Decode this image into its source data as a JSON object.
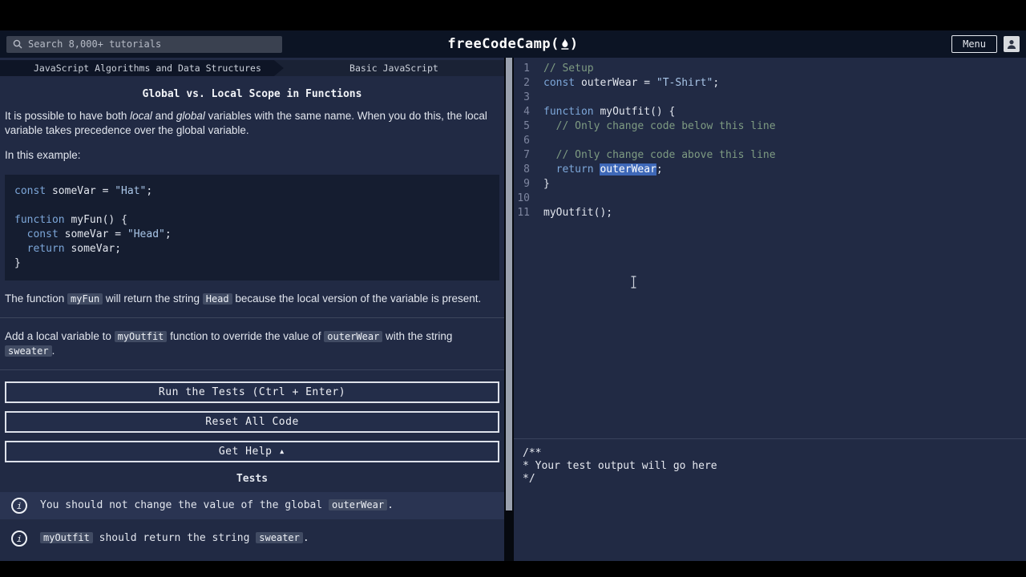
{
  "colors": {
    "selection_highlight": "#3e68b8",
    "panel_background": "#212a44",
    "header_background": "#0c1424",
    "comment_green": "#7e9b82",
    "keyword_blue": "#7da7d9"
  },
  "header": {
    "search_placeholder": "Search 8,000+ tutorials",
    "logo_text": "freeCodeCamp",
    "logo_open": "(",
    "logo_close": ")",
    "menu_label": "Menu"
  },
  "breadcrumb": {
    "superblock": "JavaScript Algorithms and Data Structures",
    "block": "Basic JavaScript"
  },
  "panel": {
    "title": "Global vs. Local Scope in Functions",
    "intro": [
      {
        "text": "It is possible to have both ",
        "style": "plain"
      },
      {
        "text": "local",
        "style": "italic"
      },
      {
        "text": " and ",
        "style": "plain"
      },
      {
        "text": "global",
        "style": "italic"
      },
      {
        "text": " variables with the same name. When you do this, the local variable takes precedence over the global variable.",
        "style": "plain"
      }
    ],
    "example_label": "In this example:",
    "example_code": [
      [
        {
          "t": "const",
          "c": "kw"
        },
        {
          "t": " someVar = ",
          "c": "pl"
        },
        {
          "t": "\"Hat\"",
          "c": "str"
        },
        {
          "t": ";",
          "c": "pl"
        }
      ],
      [],
      [
        {
          "t": "function",
          "c": "kw"
        },
        {
          "t": " myFun() {",
          "c": "pl"
        }
      ],
      [
        {
          "t": "  ",
          "c": "pl"
        },
        {
          "t": "const",
          "c": "kw"
        },
        {
          "t": " someVar = ",
          "c": "pl"
        },
        {
          "t": "\"Head\"",
          "c": "str"
        },
        {
          "t": ";",
          "c": "pl"
        }
      ],
      [
        {
          "t": "  ",
          "c": "pl"
        },
        {
          "t": "return",
          "c": "kw"
        },
        {
          "t": " someVar;",
          "c": "pl"
        }
      ],
      [
        {
          "t": "}",
          "c": "pl"
        }
      ]
    ],
    "explain": [
      {
        "text": "The function ",
        "style": "plain"
      },
      {
        "text": "myFun",
        "style": "code"
      },
      {
        "text": " will return the string ",
        "style": "plain"
      },
      {
        "text": "Head",
        "style": "code"
      },
      {
        "text": " because the local version of the variable is present.",
        "style": "plain"
      }
    ],
    "instructions": [
      {
        "text": "Add a local variable to ",
        "style": "plain"
      },
      {
        "text": "myOutfit",
        "style": "code"
      },
      {
        "text": " function to override the value of ",
        "style": "plain"
      },
      {
        "text": "outerWear",
        "style": "code"
      },
      {
        "text": " with the string ",
        "style": "plain"
      },
      {
        "text": "sweater",
        "style": "code"
      },
      {
        "text": ".",
        "style": "plain"
      }
    ],
    "buttons": {
      "run": "Run the Tests (Ctrl + Enter)",
      "reset": "Reset All Code",
      "help": "Get Help ▴"
    },
    "tests_heading": "Tests",
    "test_icon_glyph": "i",
    "tests": [
      {
        "parts": [
          {
            "text": "You should not change the value of the global ",
            "style": "plain"
          },
          {
            "text": "outerWear",
            "style": "code"
          },
          {
            "text": ".",
            "style": "plain"
          }
        ]
      },
      {
        "parts": [
          {
            "text": "myOutfit",
            "style": "code"
          },
          {
            "text": " should return the string ",
            "style": "plain"
          },
          {
            "text": "sweater",
            "style": "code"
          },
          {
            "text": ".",
            "style": "plain"
          }
        ]
      }
    ]
  },
  "editor": {
    "lines": [
      {
        "n": "1",
        "tokens": [
          {
            "t": "// Setup",
            "c": "cmt"
          }
        ]
      },
      {
        "n": "2",
        "tokens": [
          {
            "t": "const",
            "c": "kw"
          },
          {
            "t": " outerWear = ",
            "c": "pl"
          },
          {
            "t": "\"T-Shirt\"",
            "c": "str"
          },
          {
            "t": ";",
            "c": "pl"
          }
        ]
      },
      {
        "n": "3",
        "tokens": []
      },
      {
        "n": "4",
        "tokens": [
          {
            "t": "function",
            "c": "kw"
          },
          {
            "t": " myOutfit() {",
            "c": "pl"
          }
        ]
      },
      {
        "n": "5",
        "tokens": [
          {
            "t": "  ",
            "c": "pl"
          },
          {
            "t": "// Only change code below this line",
            "c": "cmt"
          }
        ]
      },
      {
        "n": "6",
        "tokens": []
      },
      {
        "n": "7",
        "tokens": [
          {
            "t": "  ",
            "c": "pl"
          },
          {
            "t": "// Only change code above this line",
            "c": "cmt"
          }
        ]
      },
      {
        "n": "8",
        "tokens": [
          {
            "t": "  ",
            "c": "pl"
          },
          {
            "t": "return",
            "c": "kw"
          },
          {
            "t": " ",
            "c": "pl"
          },
          {
            "t": "outerWear",
            "c": "sel"
          },
          {
            "t": ";",
            "c": "pl"
          }
        ]
      },
      {
        "n": "9",
        "tokens": [
          {
            "t": "}",
            "c": "pl"
          }
        ]
      },
      {
        "n": "10",
        "tokens": []
      },
      {
        "n": "11",
        "tokens": [
          {
            "t": "myOutfit();",
            "c": "pl"
          }
        ]
      }
    ],
    "output_lines": [
      "/**",
      "* Your test output will go here",
      "*/"
    ]
  }
}
